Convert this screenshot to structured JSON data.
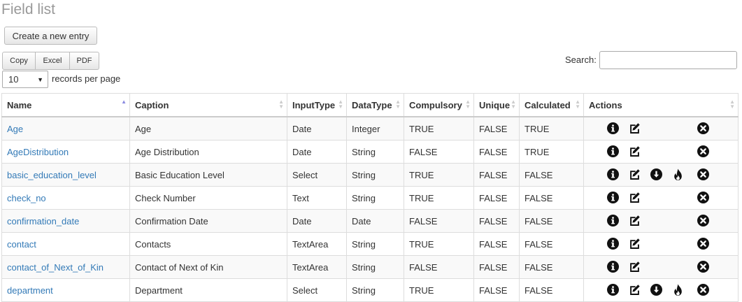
{
  "page": {
    "title": "Field list"
  },
  "toolbar": {
    "create_label": "Create a new entry",
    "export": [
      "Copy",
      "Excel",
      "PDF"
    ]
  },
  "search": {
    "label": "Search:",
    "value": ""
  },
  "length": {
    "selected": "10",
    "suffix": "records per page"
  },
  "table": {
    "columns": [
      "Name",
      "Caption",
      "InputType",
      "DataType",
      "Compulsory",
      "Unique",
      "Calculated",
      "Actions"
    ],
    "rows": [
      {
        "name": "Age",
        "caption": "Age",
        "input": "Date",
        "dtype": "Integer",
        "comp": "TRUE",
        "uniq": "FALSE",
        "calc": "TRUE",
        "actions": [
          "info-icon",
          "edit-icon",
          "delete-icon"
        ]
      },
      {
        "name": "AgeDistribution",
        "caption": "Age Distribution",
        "input": "Date",
        "dtype": "String",
        "comp": "FALSE",
        "uniq": "FALSE",
        "calc": "TRUE",
        "actions": [
          "info-icon",
          "edit-icon",
          "delete-icon"
        ]
      },
      {
        "name": "basic_education_level",
        "caption": "Basic Education Level",
        "input": "Select",
        "dtype": "String",
        "comp": "TRUE",
        "uniq": "FALSE",
        "calc": "FALSE",
        "actions": [
          "info-icon",
          "edit-icon",
          "download-icon",
          "fire-icon",
          "delete-icon"
        ]
      },
      {
        "name": "check_no",
        "caption": "Check Number",
        "input": "Text",
        "dtype": "String",
        "comp": "TRUE",
        "uniq": "FALSE",
        "calc": "FALSE",
        "actions": [
          "info-icon",
          "edit-icon",
          "delete-icon"
        ]
      },
      {
        "name": "confirmation_date",
        "caption": "Confirmation Date",
        "input": "Date",
        "dtype": "Date",
        "comp": "FALSE",
        "uniq": "FALSE",
        "calc": "FALSE",
        "actions": [
          "info-icon",
          "edit-icon",
          "delete-icon"
        ]
      },
      {
        "name": "contact",
        "caption": "Contacts",
        "input": "TextArea",
        "dtype": "String",
        "comp": "TRUE",
        "uniq": "FALSE",
        "calc": "FALSE",
        "actions": [
          "info-icon",
          "edit-icon",
          "delete-icon"
        ]
      },
      {
        "name": "contact_of_Next_of_Kin",
        "caption": "Contact of Next of Kin",
        "input": "TextArea",
        "dtype": "String",
        "comp": "FALSE",
        "uniq": "FALSE",
        "calc": "FALSE",
        "actions": [
          "info-icon",
          "edit-icon",
          "delete-icon"
        ]
      },
      {
        "name": "department",
        "caption": "Department",
        "input": "Select",
        "dtype": "String",
        "comp": "TRUE",
        "uniq": "FALSE",
        "calc": "FALSE",
        "actions": [
          "info-icon",
          "edit-icon",
          "download-icon",
          "fire-icon",
          "delete-icon"
        ]
      }
    ]
  },
  "colors": {
    "link": "#337ab7",
    "title": "#999999",
    "sort_active": "#8a8ae0"
  }
}
